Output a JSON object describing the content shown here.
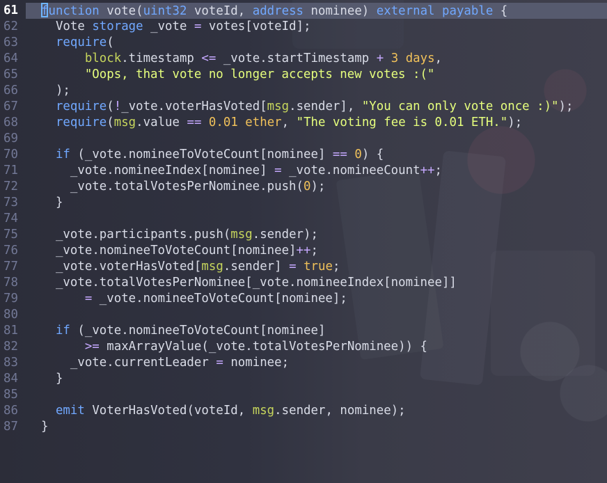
{
  "editor": {
    "current_line": "61",
    "colors": {
      "background": "#31323f",
      "current_line_background": "#5c6076",
      "line_number": "#727896",
      "keyword": "#71a8ff",
      "number": "#f0c15a",
      "string": "#e6ff7d",
      "operator": "#c6a9ff",
      "cursor": "#6fb6ff"
    }
  },
  "lines": [
    {
      "n": "61",
      "t": "function vote(uint32 voteId, address nominee) external payable {"
    },
    {
      "n": "62",
      "t": "  Vote storage _vote = votes[voteId];"
    },
    {
      "n": "63",
      "t": "  require("
    },
    {
      "n": "64",
      "t": "      block.timestamp <= _vote.startTimestamp + 3 days,"
    },
    {
      "n": "65",
      "t": "      \"Oops, that vote no longer accepts new votes :(\""
    },
    {
      "n": "66",
      "t": "  );"
    },
    {
      "n": "67",
      "t": "  require(!_vote.voterHasVoted[msg.sender], \"You can only vote once :)\");"
    },
    {
      "n": "68",
      "t": "  require(msg.value == 0.01 ether, \"The voting fee is 0.01 ETH.\");"
    },
    {
      "n": "69",
      "t": ""
    },
    {
      "n": "70",
      "t": "  if (_vote.nomineeToVoteCount[nominee] == 0) {"
    },
    {
      "n": "71",
      "t": "    _vote.nomineeIndex[nominee] = _vote.nomineeCount++;"
    },
    {
      "n": "72",
      "t": "    _vote.totalVotesPerNominee.push(0);"
    },
    {
      "n": "73",
      "t": "  }"
    },
    {
      "n": "74",
      "t": ""
    },
    {
      "n": "75",
      "t": "  _vote.participants.push(msg.sender);"
    },
    {
      "n": "76",
      "t": "  _vote.nomineeToVoteCount[nominee]++;"
    },
    {
      "n": "77",
      "t": "  _vote.voterHasVoted[msg.sender] = true;"
    },
    {
      "n": "78",
      "t": "  _vote.totalVotesPerNominee[_vote.nomineeIndex[nominee]]"
    },
    {
      "n": "79",
      "t": "      = _vote.nomineeToVoteCount[nominee];"
    },
    {
      "n": "80",
      "t": ""
    },
    {
      "n": "81",
      "t": "  if (_vote.nomineeToVoteCount[nominee]"
    },
    {
      "n": "82",
      "t": "      >= maxArrayValue(_vote.totalVotesPerNominee)) {"
    },
    {
      "n": "83",
      "t": "    _vote.currentLeader = nominee;"
    },
    {
      "n": "84",
      "t": "  }"
    },
    {
      "n": "85",
      "t": ""
    },
    {
      "n": "86",
      "t": "  emit VoterHasVoted(voteId, msg.sender, nominee);"
    },
    {
      "n": "87",
      "t": "}"
    }
  ]
}
